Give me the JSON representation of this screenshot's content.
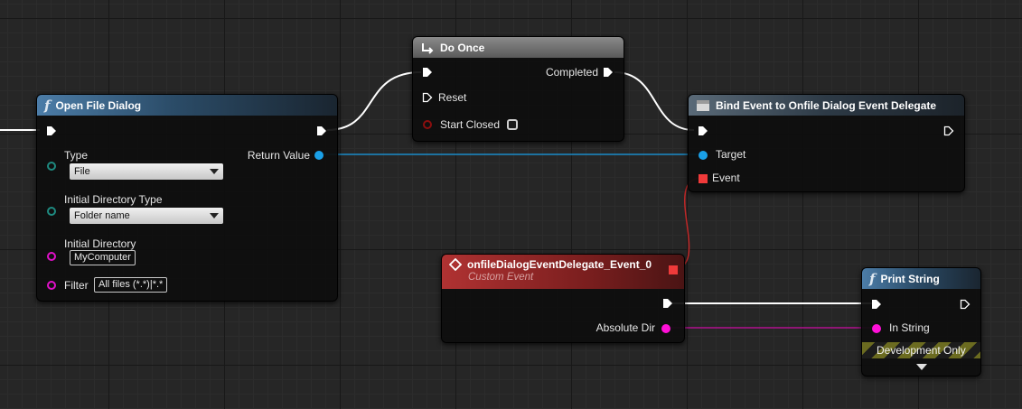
{
  "nodes": {
    "open_file_dialog": {
      "title": "Open File Dialog",
      "icon": "function-icon",
      "return_value_label": "Return Value",
      "type_label": "Type",
      "type_value": "File",
      "initial_directory_type_label": "Initial Directory Type",
      "initial_directory_type_value": "Folder name",
      "initial_directory_label": "Initial Directory",
      "initial_directory_value": "MyComputer",
      "filter_label": "Filter",
      "filter_value": "All files (*.*)|*.*"
    },
    "do_once": {
      "title": "Do Once",
      "icon": "do-once-icon",
      "completed_label": "Completed",
      "reset_label": "Reset",
      "start_closed_label": "Start Closed"
    },
    "bind_event": {
      "title": "Bind Event to Onfile Dialog Event Delegate",
      "icon": "event-dispatcher-icon",
      "target_label": "Target",
      "event_label": "Event"
    },
    "custom_event": {
      "title": "onfileDialogEventDelegate_Event_0",
      "subtitle": "Custom Event",
      "icon": "event-diamond-icon",
      "absolute_dir_label": "Absolute Dir"
    },
    "print_string": {
      "title": "Print String",
      "icon": "function-icon",
      "in_string_label": "In String",
      "development_only_label": "Development Only"
    }
  },
  "colors": {
    "exec": "#ffffff",
    "object_pin": "#1aa0e8",
    "string_pin": "#ff10d8",
    "delegate_pin": "#f03a3a",
    "enum_pin": "#1e8a80",
    "bool_pin": "#8c0e0e"
  }
}
